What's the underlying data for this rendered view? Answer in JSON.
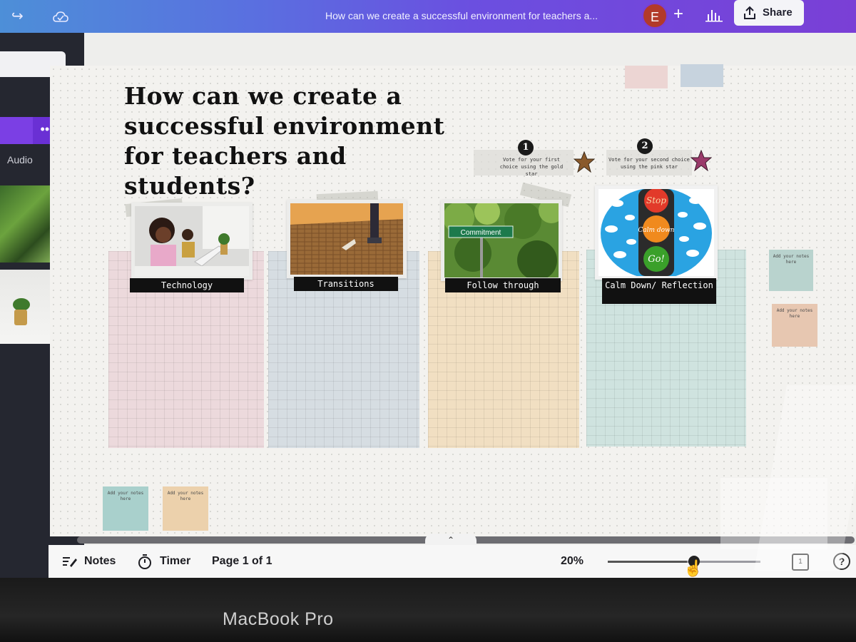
{
  "topbar": {
    "document_title": "How can we create a successful environment for teachers a...",
    "avatar_initial": "E",
    "share_label": "Share",
    "colors": {
      "gradient_start": "#4d8fd8",
      "gradient_end": "#7a3fd6"
    }
  },
  "left_panel": {
    "audio_label": "Audio"
  },
  "board": {
    "title": "How can we create a successful environment for teachers and students?",
    "vote_1": {
      "number": "1",
      "text": "Vote for your first choice using the gold star"
    },
    "vote_2": {
      "number": "2",
      "text": "Vote for your second choice using the pink star"
    },
    "columns": [
      {
        "label": "Technology",
        "color": "#ecd9dc"
      },
      {
        "label": "Transitions",
        "color": "#d6dde2"
      },
      {
        "label": "Follow through",
        "color": "#f1dfc2"
      },
      {
        "label": "Calm Down/ Reflection",
        "color": "#cfe3df"
      }
    ],
    "street_sign": "Commitment",
    "traffic_light": [
      "Stop",
      "Calm down",
      "Go!"
    ],
    "sticky_note_text": "Add your notes here"
  },
  "bottom_bar": {
    "notes_label": "Notes",
    "timer_label": "Timer",
    "page_label": "Page 1 of 1",
    "zoom_label": "20%",
    "zoom_level": 0.52,
    "page_count": "1",
    "help": "?"
  },
  "device": {
    "label": "MacBook Pro"
  },
  "icons": [
    "undo-icon",
    "cloud-icon",
    "plus-icon",
    "insights-icon",
    "share-icon",
    "notes-icon",
    "timer-icon",
    "chevron-up-icon",
    "chevron-left-icon",
    "pages-icon",
    "help-icon",
    "crown-icon",
    "more-icon",
    "star-icon",
    "pointer-hand-icon"
  ]
}
